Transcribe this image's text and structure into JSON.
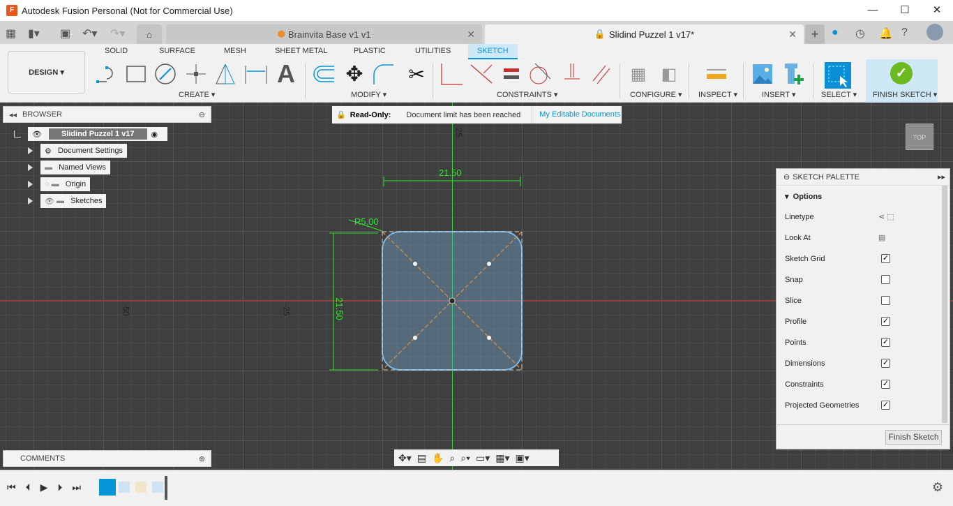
{
  "window": {
    "title": "Autodesk Fusion Personal (Not for Commercial Use)",
    "logo_letter": "F",
    "minimize": "—",
    "maximize": "☐",
    "close": "✕"
  },
  "tabs": [
    {
      "label": "Brainvita Base v1 v1",
      "active": false
    },
    {
      "label": "Slidind Puzzel 1 v17*",
      "active": true
    }
  ],
  "toolbar": {
    "workspace": "DESIGN",
    "tabs": [
      "SOLID",
      "SURFACE",
      "MESH",
      "SHEET METAL",
      "PLASTIC",
      "UTILITIES",
      "SKETCH"
    ],
    "active_tab": "SKETCH",
    "groups": [
      "CREATE",
      "MODIFY",
      "CONSTRAINTS",
      "CONFIGURE",
      "INSPECT",
      "INSERT",
      "SELECT",
      "FINISH SKETCH"
    ],
    "text_tool": "A"
  },
  "banner": {
    "label": "Read-Only:",
    "message": "Document limit has been reached",
    "link": "My Editable Documents"
  },
  "browser": {
    "title": "BROWSER",
    "root": "Slidind Puzzel 1 v17",
    "items": [
      "Document Settings",
      "Named Views",
      "Origin",
      "Sketches"
    ]
  },
  "comments": {
    "title": "COMMENTS"
  },
  "sketch": {
    "width_dim": "21.50",
    "height_dim": "21.50",
    "radius_dim": "R5.00",
    "axis_labels": [
      "25",
      "-50",
      "-25"
    ]
  },
  "viewcube": {
    "label": "TOP"
  },
  "palette": {
    "title": "SKETCH PALETTE",
    "section": "Options",
    "rows": [
      {
        "label": "Linetype",
        "type": "icons"
      },
      {
        "label": "Look At",
        "type": "icon"
      },
      {
        "label": "Sketch Grid",
        "checked": true
      },
      {
        "label": "Snap",
        "checked": false
      },
      {
        "label": "Slice",
        "checked": false
      },
      {
        "label": "Profile",
        "checked": true
      },
      {
        "label": "Points",
        "checked": true
      },
      {
        "label": "Dimensions",
        "checked": true
      },
      {
        "label": "Constraints",
        "checked": true
      },
      {
        "label": "Projected Geometries",
        "checked": true
      }
    ],
    "finish_button": "Finish Sketch"
  },
  "colors": {
    "accent": "#0696d7",
    "finish": "#6cbb1e",
    "readonly": "#d0222c",
    "axis_x": "#c8302c",
    "axis_y": "#2ecc40",
    "dim": "#2ee82e",
    "sketch": "#7ab8e6"
  }
}
